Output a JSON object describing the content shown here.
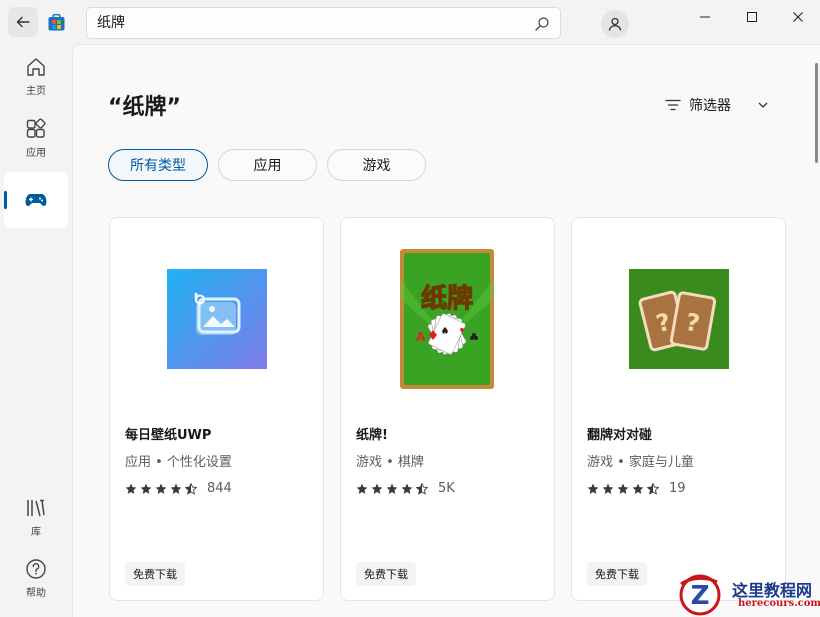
{
  "search": {
    "value": "纸牌"
  },
  "sidebar": {
    "items": [
      {
        "label": "主页",
        "icon": "home-icon"
      },
      {
        "label": "应用",
        "icon": "apps-icon"
      },
      {
        "label": "",
        "icon": "gamepad-icon"
      },
      {
        "label": "库",
        "icon": "library-icon"
      },
      {
        "label": "帮助",
        "icon": "help-icon"
      }
    ]
  },
  "main": {
    "title": "“纸牌”",
    "filter_label": "筛选器",
    "chips": [
      {
        "label": "所有类型"
      },
      {
        "label": "应用"
      },
      {
        "label": "游戏"
      }
    ],
    "results": [
      {
        "name": "每日壁纸UWP",
        "category": "应用 • 个性化设置",
        "rating": 4.5,
        "count": "844",
        "badge": "免费下载"
      },
      {
        "name": "纸牌!",
        "category": "游戏 • 棋牌",
        "rating": 4.5,
        "count": "5K",
        "badge": "免费下载",
        "art_text": "纸牌"
      },
      {
        "name": "翻牌对对碰",
        "category": "游戏 • 家庭与儿童",
        "rating": 4.5,
        "count": "19",
        "badge": "免费下载"
      }
    ]
  },
  "watermark": {
    "title": "这里教程网",
    "url": "herecours.com"
  },
  "colors": {
    "accent": "#005a9e",
    "card_border": "#e5e5e5",
    "green": "#3b8a1e"
  }
}
